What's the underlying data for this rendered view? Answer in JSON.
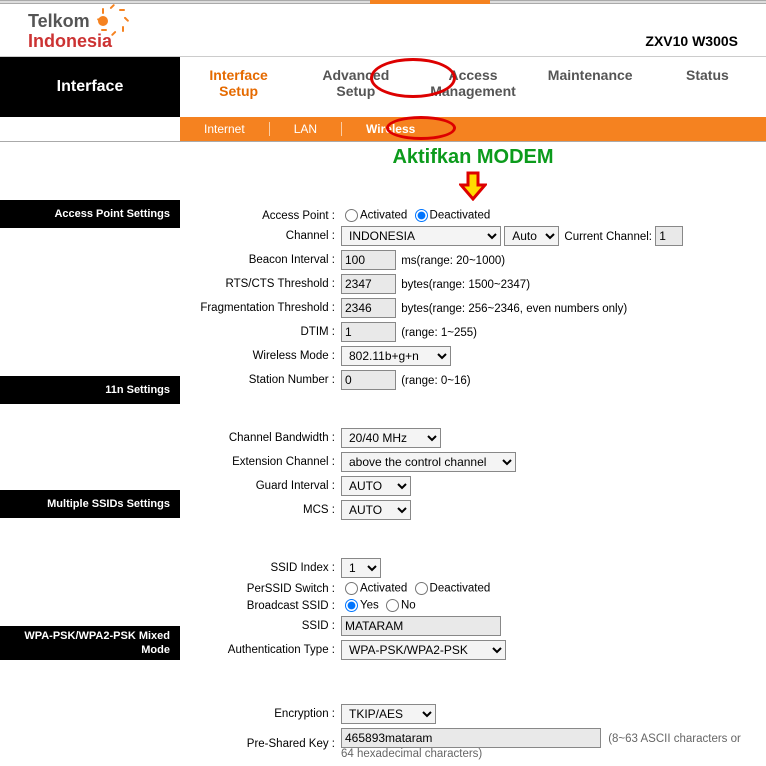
{
  "brand": {
    "top": "Telkom",
    "bottom": "Indonesia"
  },
  "model": "ZXV10 W300S",
  "page_title": "Interface",
  "tabs": {
    "interface_setup": "Interface\nSetup",
    "advanced_setup": "Advanced\nSetup",
    "access_management": "Access\nManagement",
    "maintenance": "Maintenance",
    "status": "Status"
  },
  "subtabs": {
    "internet": "Internet",
    "lan": "LAN",
    "wireless": "Wireless"
  },
  "annotation": "Aktifkan MODEM",
  "sections": {
    "ap": "Access Point Settings",
    "n11": "11n Settings",
    "mssid": "Multiple SSIDs Settings",
    "wpa": "WPA-PSK/WPA2-PSK Mixed Mode"
  },
  "labels": {
    "access_point": "Access Point :",
    "channel": "Channel :",
    "current_channel": "Current Channel:",
    "beacon": "Beacon Interval :",
    "beacon_hint": "ms(range: 20~1000)",
    "rts": "RTS/CTS Threshold :",
    "rts_hint": "bytes(range: 1500~2347)",
    "frag": "Fragmentation Threshold :",
    "frag_hint": "bytes(range: 256~2346, even numbers only)",
    "dtim": "DTIM :",
    "dtim_hint": "(range: 1~255)",
    "wmode": "Wireless Mode :",
    "station": "Station Number :",
    "station_hint": "(range: 0~16)",
    "ch_bw": "Channel Bandwidth :",
    "ext_ch": "Extension Channel :",
    "guard": "Guard Interval :",
    "mcs": "MCS :",
    "ssid_index": "SSID Index :",
    "perssid": "PerSSID Switch :",
    "bcast": "Broadcast SSID :",
    "ssid": "SSID :",
    "auth": "Authentication Type :",
    "enc": "Encryption :",
    "psk": "Pre-Shared Key :",
    "psk_hint": "(8~63 ASCII characters or 64 hexadecimal characters)"
  },
  "radio": {
    "activated": "Activated",
    "deactivated": "Deactivated",
    "yes": "Yes",
    "no": "No"
  },
  "values": {
    "channel_country": "INDONESIA",
    "channel_auto": "Auto",
    "current_channel": "1",
    "beacon": "100",
    "rts": "2347",
    "frag": "2346",
    "dtim": "1",
    "wmode": "802.11b+g+n",
    "station": "0",
    "ch_bw": "20/40 MHz",
    "ext_ch": "above the control channel",
    "guard": "AUTO",
    "mcs": "AUTO",
    "ssid_index": "1",
    "ssid": "MATARAM",
    "auth": "WPA-PSK/WPA2-PSK",
    "enc": "TKIP/AES",
    "psk": "465893mataram"
  }
}
